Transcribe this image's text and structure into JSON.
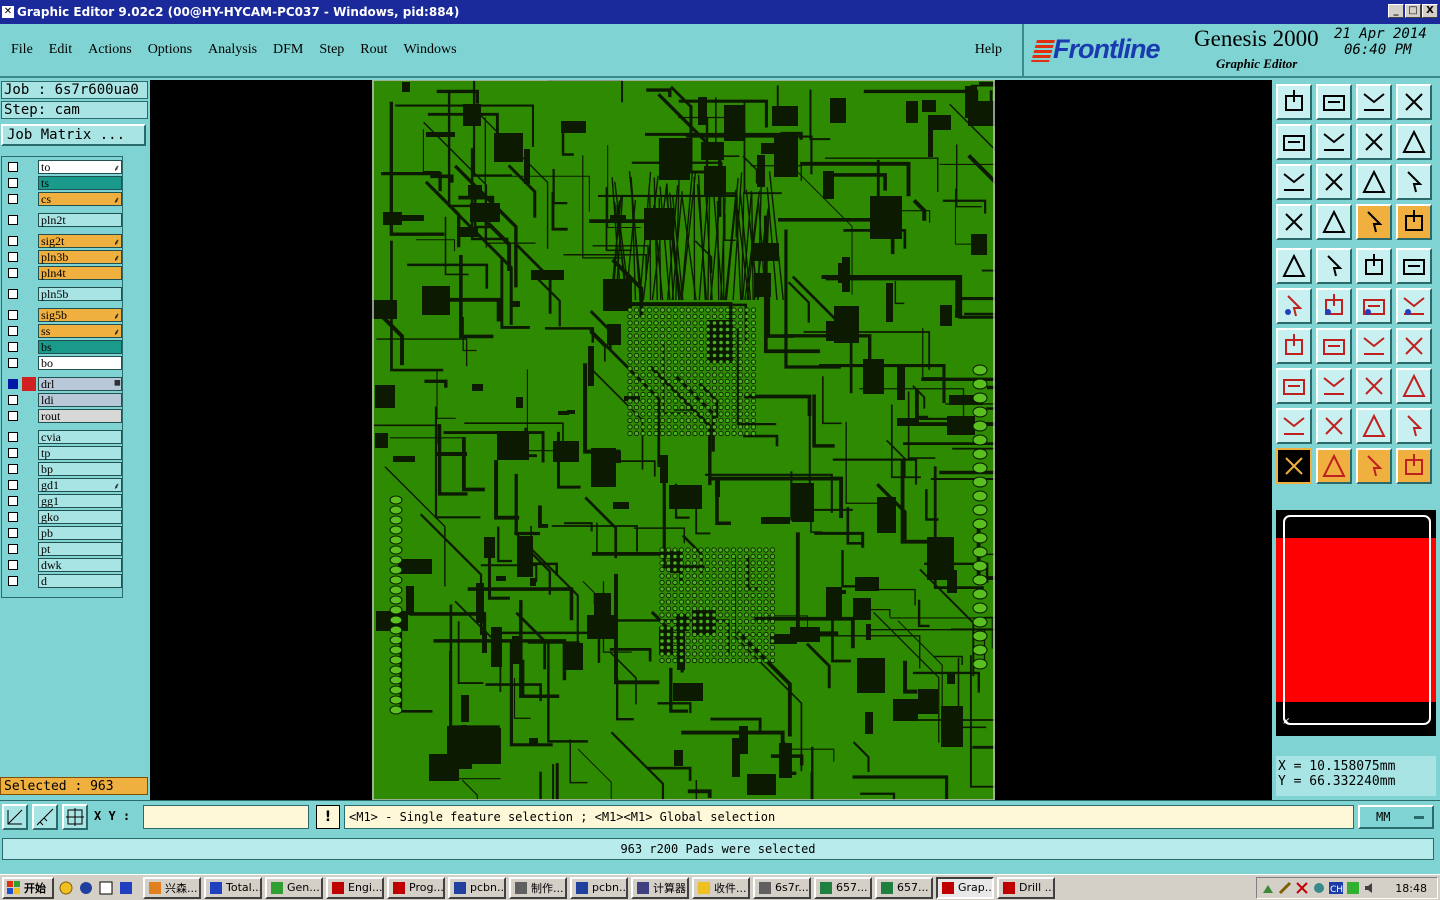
{
  "window": {
    "title": "Graphic Editor 9.02c2 (00@HY-HYCAM-PC037 - Windows, pid:884)",
    "buttons": [
      "_",
      "□",
      "X"
    ]
  },
  "menu": {
    "items": [
      "File",
      "Edit",
      "Actions",
      "Options",
      "Analysis",
      "DFM",
      "Step",
      "Rout",
      "Windows"
    ],
    "help": "Help"
  },
  "brand": {
    "logo": "Frontline",
    "product": "Genesis 2000",
    "subtitle": "Graphic Editor",
    "date": "21 Apr 2014",
    "time": "06:40 PM"
  },
  "job": {
    "job_label": "Job : 6s7r600ua0",
    "step_label": "Step: cam",
    "matrix_button": "Job Matrix ..."
  },
  "layers": [
    {
      "name": "to",
      "color": "#ffffff",
      "mark": "⸙"
    },
    {
      "name": "ts",
      "color": "#1a9a8a",
      "mark": ""
    },
    {
      "name": "cs",
      "color": "#f0b040",
      "mark": "⸙"
    },
    {
      "name": "pln2t",
      "color": "#a8e4e4",
      "mark": ""
    },
    {
      "name": "sig2t",
      "color": "#f0b040",
      "mark": "⸙"
    },
    {
      "name": "pln3b",
      "color": "#f0b040",
      "mark": "⸙"
    },
    {
      "name": "pln4t",
      "color": "#f0b040",
      "mark": ""
    },
    {
      "name": "pln5b",
      "color": "#a8e4e4",
      "mark": ""
    },
    {
      "name": "sig5b",
      "color": "#f0b040",
      "mark": "⸙"
    },
    {
      "name": "ss",
      "color": "#f0b040",
      "mark": "⸙"
    },
    {
      "name": "bs",
      "color": "#1a9a8a",
      "mark": ""
    },
    {
      "name": "bo",
      "color": "#ffffff",
      "mark": ""
    },
    {
      "name": "drl",
      "color": "#b8c8d8",
      "mark": "▦"
    },
    {
      "name": "ldi",
      "color": "#b8c8d8",
      "mark": ""
    },
    {
      "name": "rout",
      "color": "#d8d8d8",
      "mark": ""
    },
    {
      "name": "cvia",
      "color": "#a8e4e4",
      "mark": ""
    },
    {
      "name": "tp",
      "color": "#a8e4e4",
      "mark": ""
    },
    {
      "name": "bp",
      "color": "#a8e4e4",
      "mark": ""
    },
    {
      "name": "gd1",
      "color": "#a8e4e4",
      "mark": "⸙"
    },
    {
      "name": "gg1",
      "color": "#a8e4e4",
      "mark": ""
    },
    {
      "name": "gko",
      "color": "#a8e4e4",
      "mark": ""
    },
    {
      "name": "pb",
      "color": "#a8e4e4",
      "mark": ""
    },
    {
      "name": "pt",
      "color": "#a8e4e4",
      "mark": ""
    },
    {
      "name": "dwk",
      "color": "#a8e4e4",
      "mark": ""
    },
    {
      "name": "d",
      "color": "#a8e4e4",
      "mark": ""
    }
  ],
  "selected": "Selected : 963",
  "coords": {
    "x": "X = 10.158075mm",
    "y": "Y = 66.332240mm"
  },
  "command": {
    "xy_label": "X Y :",
    "xy_value": "",
    "warn": "!",
    "prompt": "<M1> - Single feature selection ; <M1><M1> Global selection",
    "units": "MM"
  },
  "status": "963 r200 Pads were selected",
  "taskbar": {
    "start": "开始",
    "tasks": [
      {
        "label": "兴森...",
        "icon": "star-icon"
      },
      {
        "label": "Total...",
        "icon": "disk-icon"
      },
      {
        "label": "Gen...",
        "icon": "globe-icon"
      },
      {
        "label": "Engi...",
        "icon": "x-icon"
      },
      {
        "label": "Prog...",
        "icon": "x-icon"
      },
      {
        "label": "pcbn...",
        "icon": "shield-icon"
      },
      {
        "label": "制作...",
        "icon": "doc-icon"
      },
      {
        "label": "pcbn...",
        "icon": "shield-icon"
      },
      {
        "label": "计算器",
        "icon": "calc-icon"
      },
      {
        "label": "收件...",
        "icon": "clock-icon"
      },
      {
        "label": "6s7r...",
        "icon": "doc-icon"
      },
      {
        "label": "657...",
        "icon": "excel-icon"
      },
      {
        "label": "657...",
        "icon": "excel-icon"
      },
      {
        "label": "Grap...",
        "icon": "x-icon",
        "active": true
      },
      {
        "label": "Drill ...",
        "icon": "x-icon"
      }
    ],
    "clock": "18:48"
  },
  "colors": {
    "board": "#2e8a00",
    "trace": "#0b1a00",
    "panel": "#7fd3d3",
    "title": "#1a2a9a"
  }
}
